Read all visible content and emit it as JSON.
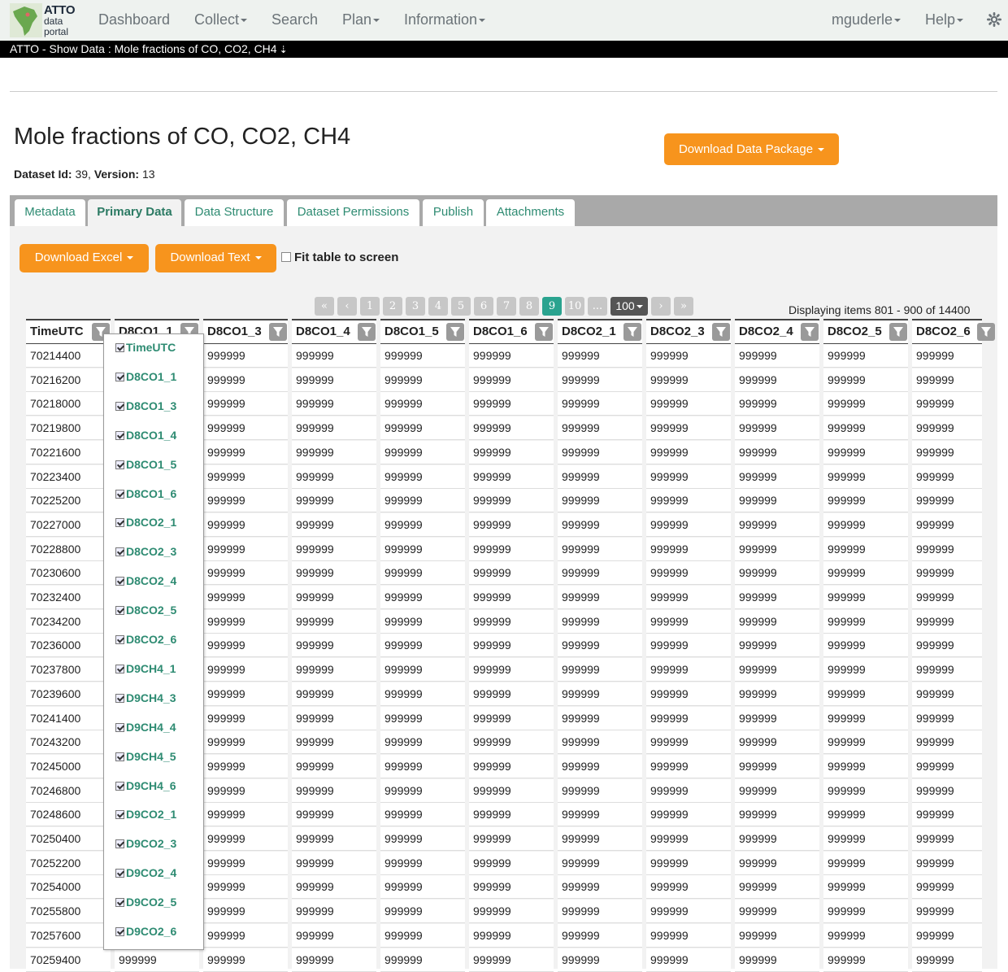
{
  "logo": {
    "line1": "ATTO",
    "line2": "data",
    "line3": "portal"
  },
  "nav": {
    "dashboard": "Dashboard",
    "collect": "Collect",
    "search": "Search",
    "plan": "Plan",
    "information": "Information",
    "user": "mguderle",
    "help": "Help"
  },
  "breadcrumb": {
    "text": "ATTO - Show Data : Mole fractions of CO, CO2, CH4"
  },
  "page": {
    "title": "Mole fractions of CO, CO2, CH4",
    "dataset_id_label": "Dataset Id:",
    "dataset_id": "39",
    "version_label": "Version:",
    "version": "13",
    "download_package": "Download Data Package"
  },
  "tabs": [
    "Metadata",
    "Primary Data",
    "Data Structure",
    "Dataset Permissions",
    "Publish",
    "Attachments"
  ],
  "toolbar": {
    "download_excel": "Download Excel",
    "download_text": "Download Text",
    "fit_table": "Fit table to screen"
  },
  "pager": {
    "first": "«",
    "prev": "‹",
    "next": "›",
    "last": "»",
    "pages": [
      "1",
      "2",
      "3",
      "4",
      "5",
      "6",
      "7",
      "8",
      "9",
      "10"
    ],
    "active_page": "9",
    "ellipsis": "...",
    "page_size": "100",
    "displaying": "Displaying items 801 - 900 of 14400"
  },
  "table": {
    "columns": [
      "TimeUTC",
      "D8CO1_1",
      "D8CO1_3",
      "D8CO1_4",
      "D8CO1_5",
      "D8CO1_6",
      "D8CO2_1",
      "D8CO2_3",
      "D8CO2_4",
      "D8CO2_5",
      "D8CO2_6"
    ],
    "time_values": [
      "70214400",
      "70216200",
      "70218000",
      "70219800",
      "70221600",
      "70223400",
      "70225200",
      "70227000",
      "70228800",
      "70230600",
      "70232400",
      "70234200",
      "70236000",
      "70237800",
      "70239600",
      "70241400",
      "70243200",
      "70245000",
      "70246800",
      "70248600",
      "70250400",
      "70252200",
      "70254000",
      "70255800",
      "70257600",
      "70259400"
    ],
    "fill_value": "999999"
  },
  "column_menu": {
    "items": [
      "TimeUTC",
      "D8CO1_1",
      "D8CO1_3",
      "D8CO1_4",
      "D8CO1_5",
      "D8CO1_6",
      "D8CO2_1",
      "D8CO2_3",
      "D8CO2_4",
      "D8CO2_5",
      "D8CO2_6",
      "D9CH4_1",
      "D9CH4_3",
      "D9CH4_4",
      "D9CH4_5",
      "D9CH4_6",
      "D9CO2_1",
      "D9CO2_3",
      "D9CO2_4",
      "D9CO2_5",
      "D9CO2_6"
    ]
  }
}
